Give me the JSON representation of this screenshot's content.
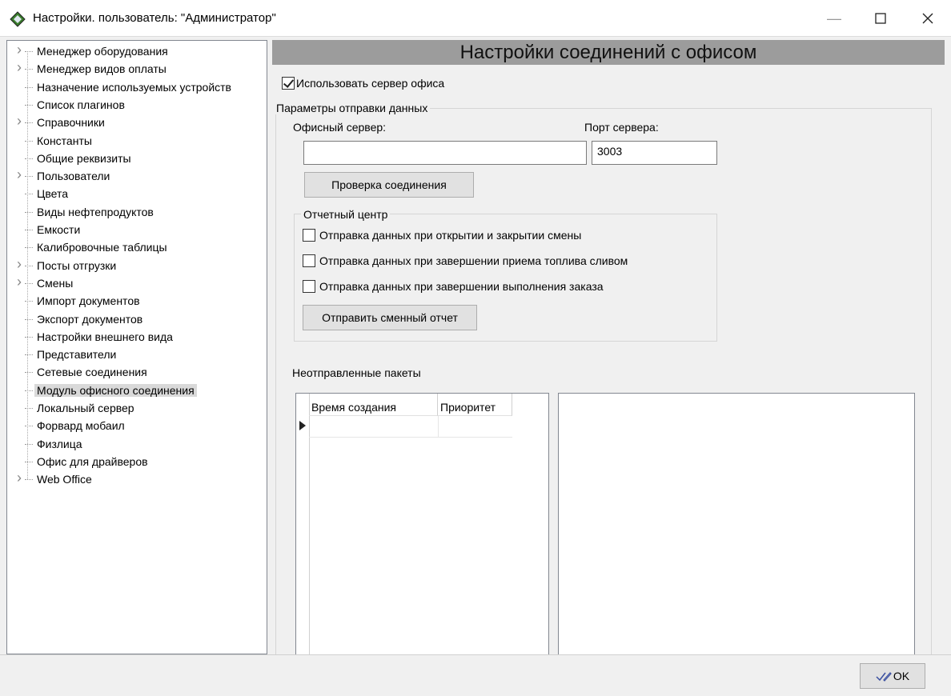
{
  "window": {
    "title": "Настройки. пользователь: \"Администратор\"",
    "minimize_icon": "minimize-icon",
    "maximize_icon": "maximize-icon",
    "close_icon": "close-icon"
  },
  "tree": {
    "items": [
      {
        "label": "Менеджер оборудования",
        "expandable": true
      },
      {
        "label": "Менеджер видов оплаты",
        "expandable": true
      },
      {
        "label": "Назначение используемых устройств",
        "expandable": false
      },
      {
        "label": "Список плагинов",
        "expandable": false
      },
      {
        "label": "Справочники",
        "expandable": true
      },
      {
        "label": "Константы",
        "expandable": false
      },
      {
        "label": "Общие реквизиты",
        "expandable": false
      },
      {
        "label": "Пользователи",
        "expandable": true
      },
      {
        "label": "Цвета",
        "expandable": false
      },
      {
        "label": "Виды нефтепродуктов",
        "expandable": false
      },
      {
        "label": "Емкости",
        "expandable": false
      },
      {
        "label": "Калибровочные таблицы",
        "expandable": false
      },
      {
        "label": "Посты отгрузки",
        "expandable": true
      },
      {
        "label": "Смены",
        "expandable": true
      },
      {
        "label": "Импорт документов",
        "expandable": false
      },
      {
        "label": "Экспорт документов",
        "expandable": false
      },
      {
        "label": "Настройки внешнего вида",
        "expandable": false
      },
      {
        "label": "Представители",
        "expandable": false
      },
      {
        "label": "Сетевые соединения",
        "expandable": false
      },
      {
        "label": "Модуль офисного соединения",
        "expandable": false,
        "selected": true
      },
      {
        "label": "Локальный сервер",
        "expandable": false
      },
      {
        "label": "Форвард мобаил",
        "expandable": false
      },
      {
        "label": "Физлица",
        "expandable": false
      },
      {
        "label": "Офис для драйверов",
        "expandable": false
      },
      {
        "label": "Web Office",
        "expandable": true
      }
    ]
  },
  "main": {
    "header": "Настройки соединений с офисом",
    "use_office_server": {
      "label": "Использовать сервер офиса",
      "checked": true
    },
    "send_params": {
      "title": "Параметры отправки данных",
      "server_label": "Офисный сервер:",
      "server_value": "",
      "port_label": "Порт сервера:",
      "port_value": "3003",
      "check_button": "Проверка соединения"
    },
    "report_center": {
      "title": "Отчетный центр",
      "options": [
        {
          "label": "Отправка данных при открытии и закрытии смены",
          "checked": false
        },
        {
          "label": "Отправка данных при завершении приема топлива сливом",
          "checked": false
        },
        {
          "label": "Отправка данных при завершении выполнения заказа",
          "checked": false
        }
      ],
      "send_button": "Отправить сменный отчет"
    },
    "unsent": {
      "title": "Неотправленные пакеты",
      "columns": [
        "Время создания",
        "Приоритет"
      ],
      "rows": []
    }
  },
  "footer": {
    "ok_label": "OK",
    "ok_icon": "check-pen-icon"
  }
}
